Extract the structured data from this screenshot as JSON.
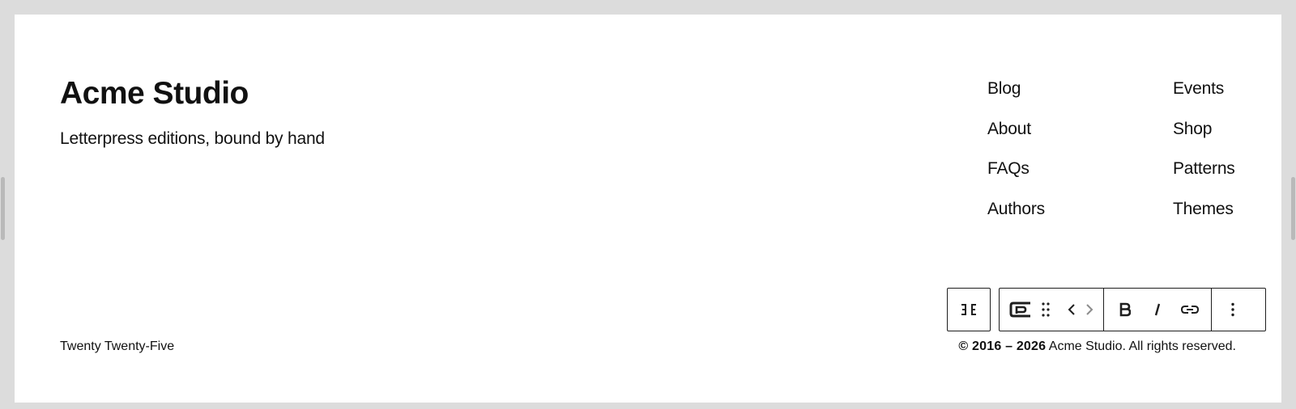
{
  "site": {
    "title": "Acme Studio",
    "tagline": "Letterpress editions, bound by hand"
  },
  "navigation": {
    "column_1": [
      "Blog",
      "About",
      "FAQs",
      "Authors"
    ],
    "column_2": [
      "Events",
      "Shop",
      "Patterns",
      "Themes"
    ]
  },
  "footer": {
    "credit": "Twenty Twenty-Five",
    "copyright_years": "© 2016 – 2026",
    "copyright_rest": " Acme Studio. All rights reserved."
  },
  "toolbar": {
    "parent_block_icon": "select-parent-icon",
    "block_type_icon": "paragraph-block-icon",
    "drag_icon": "drag-handle-icon",
    "move_left_icon": "move-left-icon",
    "move_right_icon": "move-right-icon",
    "bold_icon": "bold-icon",
    "italic_icon": "italic-icon",
    "link_icon": "link-icon",
    "options_icon": "more-options-icon"
  },
  "colors": {
    "frame_background": "#dcdcdc",
    "canvas_background": "#ffffff",
    "text": "#111111",
    "toolbar_border": "#1e1e1e"
  }
}
